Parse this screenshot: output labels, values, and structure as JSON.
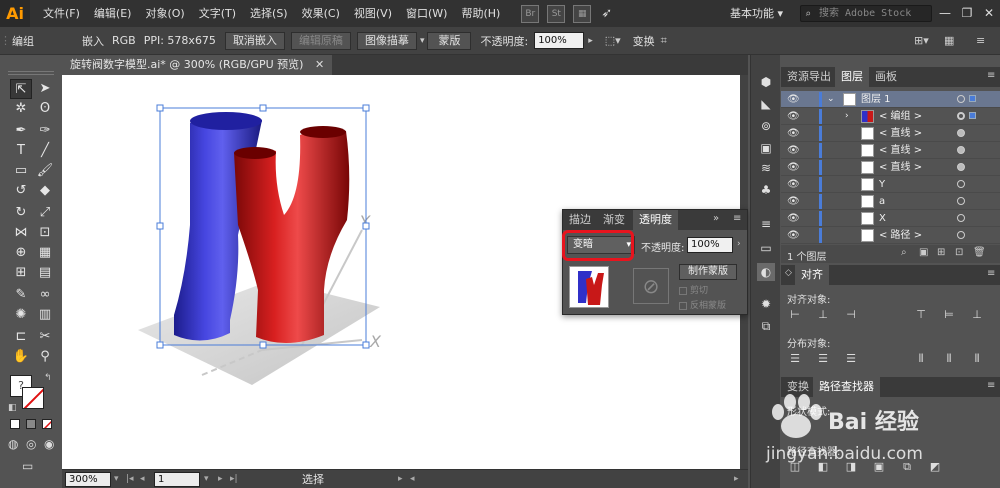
{
  "app": {
    "logo": "Ai",
    "menu": [
      "文件(F)",
      "编辑(E)",
      "对象(O)",
      "文字(T)",
      "选择(S)",
      "效果(C)",
      "视图(V)",
      "窗口(W)",
      "帮助(H)"
    ],
    "bridge_icon": "Br",
    "stock_icon": "St",
    "workspace": "基本功能 ▾",
    "search_placeholder": "搜索 Adobe Stock",
    "minimize": "—",
    "restore": "❐",
    "close": "✕"
  },
  "controlbar": {
    "group_label": "编组",
    "embed_label": "嵌入",
    "rgb_label": "RGB",
    "ppi_label": "PPI: 578x675",
    "unembed_btn": "取消嵌入",
    "edit_original_btn": "编辑原稿",
    "image_trace_btn": "图像描摹",
    "mask_btn": "蒙版",
    "opacity_label": "不透明度:",
    "opacity_value": "100%",
    "transform_label": "变换"
  },
  "document": {
    "tab_title": "旋转阀数字模型.ai* @ 300% (RGB/GPU 预览)",
    "tab_close": "✕",
    "axis_y": "Y",
    "axis_x": "X",
    "axis_z": "Z"
  },
  "statusbar": {
    "zoom": "300%",
    "page": "1",
    "status": "选择"
  },
  "panels": {
    "top_tabs": [
      "资源导出",
      "图层",
      "画板"
    ],
    "layers": [
      {
        "name": "图层 1",
        "indent": 0,
        "selected": true
      },
      {
        "name": "< 编组 >",
        "indent": 1,
        "selected": false
      },
      {
        "name": "< 直线 >",
        "indent": 2,
        "selected": false
      },
      {
        "name": "< 直线 >",
        "indent": 2,
        "selected": false
      },
      {
        "name": "< 直线 >",
        "indent": 2,
        "selected": false
      },
      {
        "name": "Y",
        "indent": 2,
        "selected": false
      },
      {
        "name": "a",
        "indent": 2,
        "selected": false
      },
      {
        "name": "X",
        "indent": 2,
        "selected": false
      },
      {
        "name": "< 路径 >",
        "indent": 2,
        "selected": false
      }
    ],
    "layer_count": "1 个图层",
    "align_tab": "对齐",
    "align_objects_label": "对齐对象:",
    "distribute_objects_label": "分布对象:",
    "bottom_tabs": [
      "变换",
      "路径查找器"
    ],
    "shape_modes_label": "形状模式:",
    "pathfinder_label": "路径查找器:"
  },
  "transparency": {
    "tabs": [
      "描边",
      "渐变",
      "透明度"
    ],
    "blend_mode": "变暗",
    "opacity_label": "不透明度:",
    "opacity_value": "100%",
    "make_mask_btn": "制作蒙版",
    "clip_label": "剪切",
    "invert_label": "反相蒙版"
  },
  "watermark": {
    "text": "Bai 经验",
    "url": "jingyan.baidu.com"
  },
  "colors": {
    "accent_blue": "#4a7cd8",
    "highlight_red": "#e8141e",
    "blue_shape": "#2f2fc8",
    "red_shape": "#c81818"
  }
}
